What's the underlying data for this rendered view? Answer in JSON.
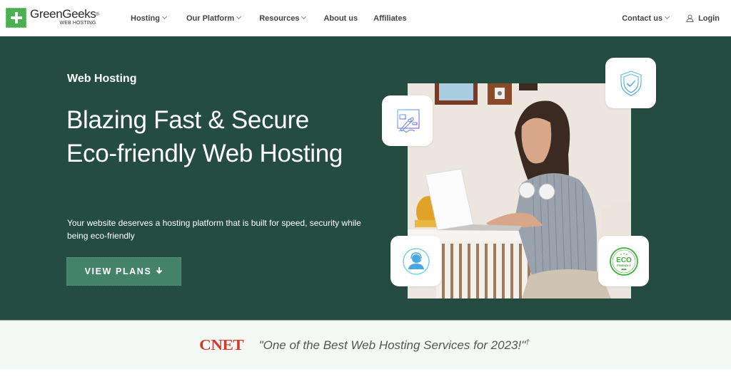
{
  "header": {
    "logo": {
      "name": "GreenGeeks",
      "registered": "®",
      "tagline": "WEB HOSTING",
      "brand_color": "#4caf50"
    },
    "nav": [
      {
        "label": "Hosting",
        "has_dropdown": true
      },
      {
        "label": "Our Platform",
        "has_dropdown": true
      },
      {
        "label": "Resources",
        "has_dropdown": true
      },
      {
        "label": "About us",
        "has_dropdown": false
      },
      {
        "label": "Affiliates",
        "has_dropdown": false
      }
    ],
    "contact": {
      "label": "Contact us",
      "has_dropdown": true
    },
    "login": {
      "label": "Login",
      "icon": "user-icon"
    }
  },
  "hero": {
    "background": "#254c40",
    "eyebrow": "Web Hosting",
    "headline": "Blazing Fast & Secure Eco-friendly Web Hosting",
    "subtitle": "Your website deserves a hosting platform that is built for speed, security while being eco-friendly",
    "cta": {
      "label": "VIEW PLANS",
      "icon": "arrow-down-icon",
      "color": "#44836a"
    },
    "feature_icons": [
      {
        "name": "rocket-website-icon"
      },
      {
        "name": "shield-check-icon"
      },
      {
        "name": "support-agent-icon"
      },
      {
        "name": "eco-friendly-badge-icon",
        "text": "ECO",
        "subtext": "FRIENDLY"
      }
    ],
    "photo_alt": "Woman working on a laptop wearing headphones"
  },
  "press": {
    "source": "CNET",
    "source_color": "#d1392b",
    "quote": "\"One of the Best Web Hosting Services for 2023!\"",
    "footnote_mark": "†"
  }
}
